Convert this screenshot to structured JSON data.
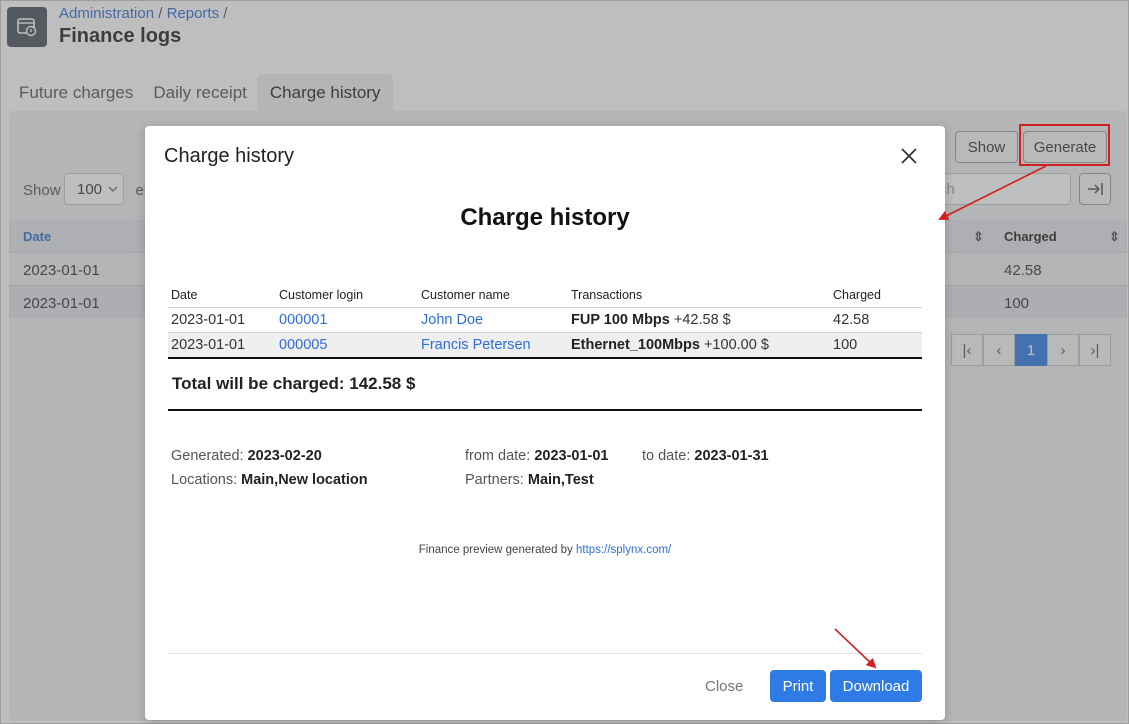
{
  "breadcrumb": {
    "item1": "Administration",
    "sep": "/",
    "item2": "Reports",
    "trail": "/"
  },
  "page": {
    "title": "Finance logs",
    "icon": "finance-log-icon"
  },
  "tabs": [
    {
      "label": "Future charges"
    },
    {
      "label": "Daily receipt"
    },
    {
      "label": "Charge history"
    }
  ],
  "toolbar": {
    "show_button": "Show",
    "generate_button": "Generate"
  },
  "entries": {
    "label": "Show",
    "value": "100",
    "suffix": "ent"
  },
  "search": {
    "placeholder": "Search",
    "visible_text": "rch"
  },
  "background_table": {
    "headers": {
      "date": "Date",
      "charged": "Charged"
    },
    "rows": [
      {
        "date": "2023-01-01",
        "charged": "42.58"
      },
      {
        "date": "2023-01-01",
        "charged": "100"
      }
    ]
  },
  "pagination": {
    "current": "1"
  },
  "modal": {
    "title": "Charge history",
    "report_title": "Charge history",
    "columns": {
      "date": "Date",
      "login": "Customer login",
      "name": "Customer name",
      "transactions": "Transactions",
      "charged": "Charged"
    },
    "rows": [
      {
        "date": "2023-01-01",
        "login": "000001",
        "name": "John Doe",
        "tx_plan": "FUP 100 Mbps",
        "tx_amount": "+42.58 $",
        "charged": "42.58"
      },
      {
        "date": "2023-01-01",
        "login": "000005",
        "name": "Francis Petersen",
        "tx_plan": "Ethernet_100Mbps",
        "tx_amount": "+100.00 $",
        "charged": "100"
      }
    ],
    "total": "Total will be charged: 142.58 $",
    "meta": {
      "generated_label": "Generated:",
      "generated_value": "2023-02-20",
      "from_label": "from date:",
      "from_value": "2023-01-01",
      "to_label": "to date:",
      "to_value": "2023-01-31",
      "locations_label": "Locations:",
      "locations_value": "Main,New location",
      "partners_label": "Partners:",
      "partners_value": "Main,Test"
    },
    "footer_text": "Finance preview generated by",
    "footer_link": "https://splynx.com/",
    "buttons": {
      "close": "Close",
      "print": "Print",
      "download": "Download"
    }
  },
  "colors": {
    "accent": "#2e7be6",
    "link": "#2e6fd6",
    "annotation": "#d21f1f"
  }
}
